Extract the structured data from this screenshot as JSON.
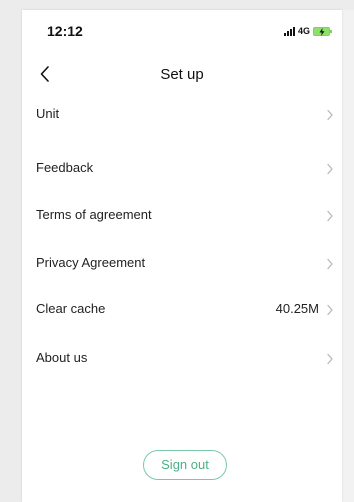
{
  "status_bar": {
    "time": "12:12",
    "network": "4G",
    "battery_color": "#8ee06c"
  },
  "header": {
    "title": "Set up",
    "back_icon": "chevron-left-icon"
  },
  "settings": {
    "items": [
      {
        "label": "Unit",
        "value": ""
      },
      {
        "label": "Feedback",
        "value": ""
      },
      {
        "label": "Terms of agreement",
        "value": ""
      },
      {
        "label": "Privacy Agreement",
        "value": ""
      },
      {
        "label": "Clear cache",
        "value": "40.25M"
      },
      {
        "label": "About us",
        "value": ""
      }
    ]
  },
  "actions": {
    "sign_out": "Sign out",
    "accent_color": "#4fae88"
  }
}
